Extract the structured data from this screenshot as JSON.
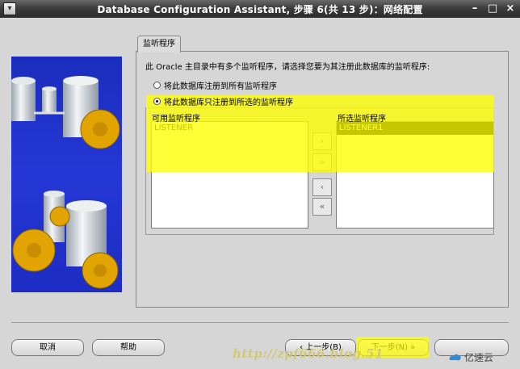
{
  "window": {
    "title": "Database Configuration Assistant, 步骤 6(共 13 步)：网络配置",
    "controls": [
      "minimize",
      "maximize",
      "close"
    ]
  },
  "tab": {
    "label": "监听程序"
  },
  "prompt": "此 Oracle 主目录中有多个监听程序，请选择您要为其注册此数据库的监听程序:",
  "radio_options": [
    {
      "label": "将此数据库注册到所有监听程序",
      "selected": false
    },
    {
      "label": "将此数据库只注册到所选的监听程序",
      "selected": true
    }
  ],
  "available": {
    "label": "可用监听程序",
    "items": [
      "LISTENER"
    ]
  },
  "selected": {
    "label": "所选监听程序",
    "items": [
      "LISTENER1"
    ]
  },
  "move_buttons": [
    {
      "icon": "move-right-icon",
      "glyph": "›"
    },
    {
      "icon": "move-all-right-icon",
      "glyph": "»"
    },
    {
      "icon": "move-left-icon",
      "glyph": "‹"
    },
    {
      "icon": "move-all-left-icon",
      "glyph": "«"
    }
  ],
  "buttons": {
    "cancel": "取消",
    "help": "帮助",
    "back": "上一步(B)",
    "next": "下一步(N)",
    "finish": ""
  },
  "watermark": "http://zpf666.blog.51",
  "brand": "亿速云",
  "colors": {
    "highlight": "#ffff00",
    "selection": "#000000",
    "side_panel": "#1f31c8"
  }
}
